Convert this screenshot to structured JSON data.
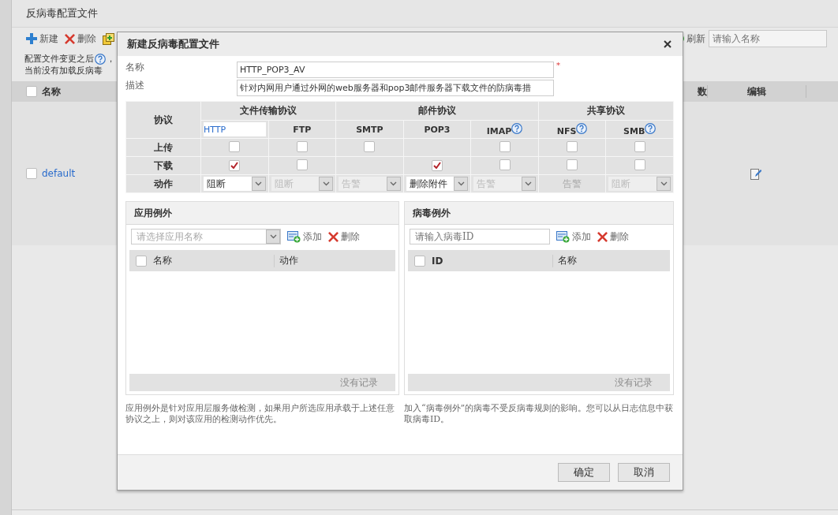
{
  "page": {
    "title": "反病毒配置文件",
    "toolbar": [
      {
        "kind": "new",
        "label": "新建"
      },
      {
        "kind": "delete",
        "label": "删除"
      },
      {
        "kind": "copy"
      }
    ],
    "refresh": "刷新",
    "search": {
      "placeholder": "请输入名称"
    },
    "notes": [
      {
        "text": "配置文件变更之后",
        "help": true,
        "suffix": "，"
      },
      {
        "text": "当前没有加载反病毒",
        "help": false
      }
    ],
    "table": {
      "header_checkbox": {
        "checked": false
      },
      "columns": [
        "名称",
        "数",
        "编辑"
      ],
      "rows": [
        {
          "name": "default",
          "checked": false
        }
      ]
    }
  },
  "dialog": {
    "title": "新建反病毒配置文件",
    "required_mark": "*",
    "fields": [
      {
        "label": "名称",
        "value": "HTTP_POP3_AV",
        "required": true
      },
      {
        "label": "描述",
        "value": "针对内网用户通过外网的web服务器和pop3邮件服务器下载文件的防病毒措",
        "required": false
      }
    ],
    "protocol_table": {
      "corner": "协议",
      "groups": [
        {
          "label": "文件传输协议",
          "protocols": [
            {
              "name": "HTTP",
              "help": false,
              "selected": true
            },
            {
              "name": "FTP",
              "help": false,
              "selected": false
            }
          ]
        },
        {
          "label": "邮件协议",
          "protocols": [
            {
              "name": "SMTP",
              "help": false,
              "selected": false
            },
            {
              "name": "POP3",
              "help": false,
              "selected": false
            },
            {
              "name": "IMAP",
              "help": true,
              "selected": false
            }
          ]
        },
        {
          "label": "共享协议",
          "protocols": [
            {
              "name": "NFS",
              "help": true,
              "selected": false
            },
            {
              "name": "SMB",
              "help": true,
              "selected": false
            }
          ]
        }
      ],
      "rows": [
        {
          "label": "上传",
          "cells": [
            {
              "kind": "checkbox",
              "checked": false
            },
            {
              "kind": "checkbox",
              "checked": false
            },
            {
              "kind": "checkbox",
              "checked": false
            },
            {
              "kind": "empty"
            },
            {
              "kind": "checkbox",
              "checked": false
            },
            {
              "kind": "checkbox",
              "checked": false
            },
            {
              "kind": "checkbox",
              "checked": false
            }
          ]
        },
        {
          "label": "下载",
          "cells": [
            {
              "kind": "checkbox",
              "checked": true
            },
            {
              "kind": "checkbox",
              "checked": false
            },
            {
              "kind": "empty"
            },
            {
              "kind": "checkbox",
              "checked": true
            },
            {
              "kind": "checkbox",
              "checked": false
            },
            {
              "kind": "checkbox",
              "checked": false
            },
            {
              "kind": "checkbox",
              "checked": false
            }
          ]
        },
        {
          "label": "动作",
          "cells": [
            {
              "kind": "select",
              "value": "阻断",
              "disabled": false
            },
            {
              "kind": "select",
              "value": "阻断",
              "disabled": true
            },
            {
              "kind": "select",
              "value": "告警",
              "disabled": true
            },
            {
              "kind": "select",
              "value": "删除附件",
              "disabled": false
            },
            {
              "kind": "select",
              "value": "告警",
              "disabled": true
            },
            {
              "kind": "text",
              "value": "告警"
            },
            {
              "kind": "select",
              "value": "阻断",
              "disabled": true
            }
          ]
        }
      ]
    },
    "exceptions": [
      {
        "title": "应用例外",
        "input": {
          "kind": "select",
          "placeholder": "请选择应用名称"
        },
        "add": "添加",
        "delete": "删除",
        "header_checkbox": {
          "checked": false
        },
        "columns": [
          "名称",
          "动作"
        ],
        "empty": "没有记录",
        "note": "应用例外是针对应用层服务做检测，如果用户所选应用承载于上述任意协议之上，则对该应用的检测动作优先。"
      },
      {
        "title": "病毒例外",
        "input": {
          "kind": "text",
          "placeholder": "请输入病毒ID"
        },
        "add": "添加",
        "delete": "删除",
        "header_checkbox": {
          "checked": false
        },
        "columns": [
          "ID",
          "名称"
        ],
        "empty": "没有记录",
        "note": "加入“病毒例外”的病毒不受反病毒规则的影响。您可以从日志信息中获取病毒ID。"
      }
    ],
    "buttons": [
      "确定",
      "取消"
    ]
  }
}
